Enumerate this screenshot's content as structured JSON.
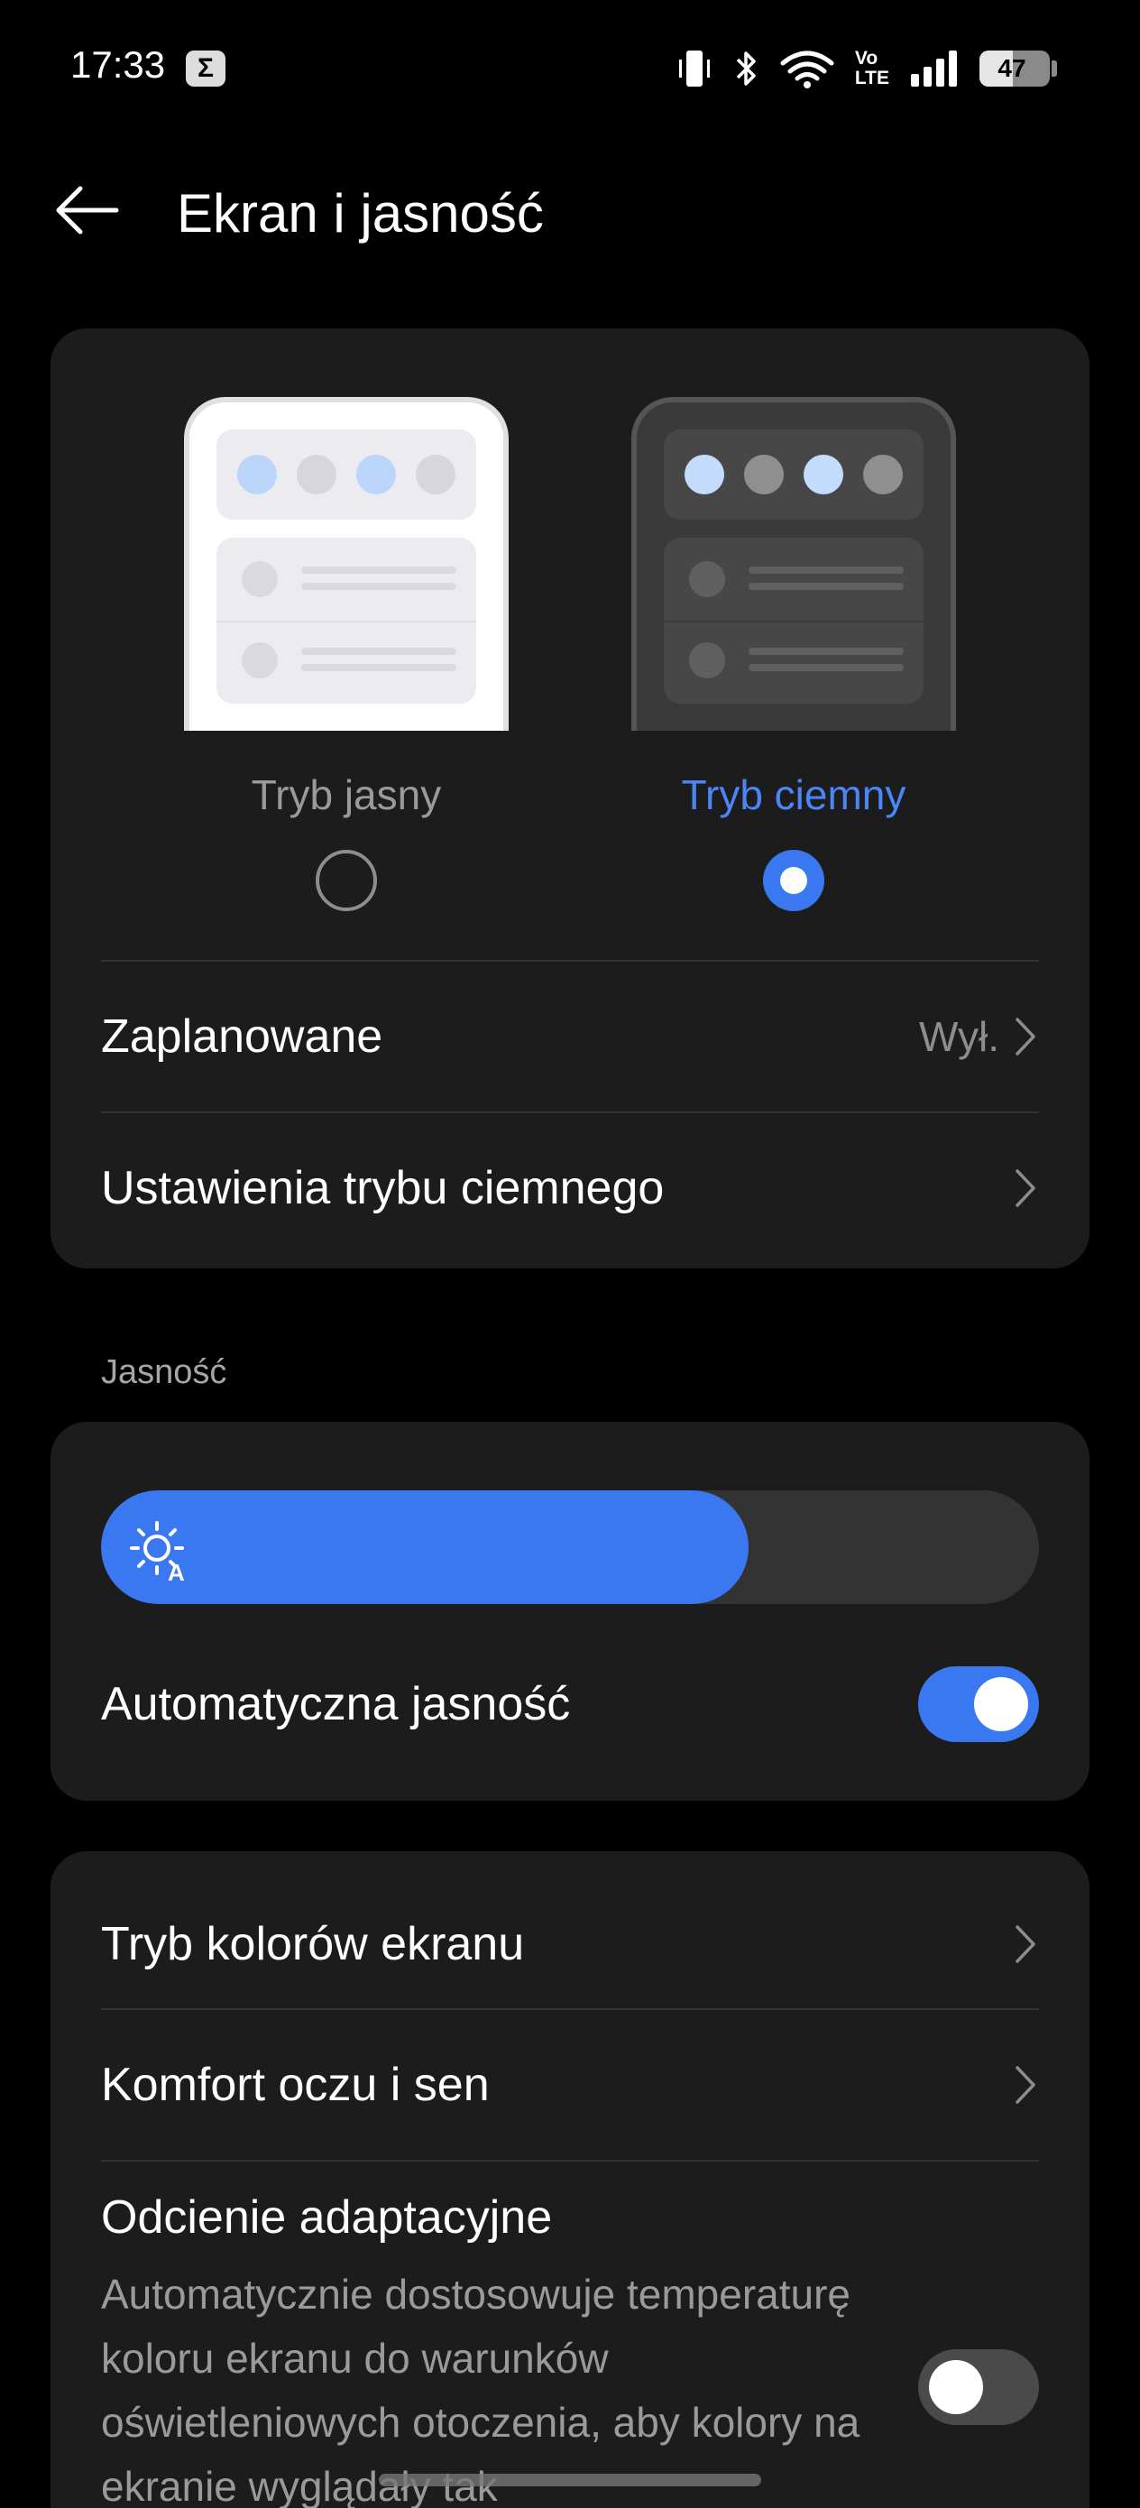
{
  "status_bar": {
    "time": "17:33",
    "notification_icon": "sigma-app-icon",
    "icons": [
      "vibrate-icon",
      "bluetooth-icon",
      "wifi-icon",
      "volte-icon",
      "signal-icon",
      "battery-icon"
    ],
    "volte_text_top": "Vo",
    "volte_text_bottom": "LTE",
    "battery_level": "47"
  },
  "header": {
    "title": "Ekran i jasność",
    "back_icon": "back-arrow-icon"
  },
  "theme_modes": {
    "light": {
      "label": "Tryb jasny",
      "selected": false
    },
    "dark": {
      "label": "Tryb ciemny",
      "selected": true
    }
  },
  "mode_rows": [
    {
      "label": "Zaplanowane",
      "value": "Wył."
    },
    {
      "label": "Ustawienia trybu ciemnego",
      "value": ""
    }
  ],
  "brightness": {
    "section_label": "Jasność",
    "level": 0.69,
    "auto_label": "Automatyczna jasność",
    "auto_enabled": true
  },
  "more_rows": [
    {
      "label": "Tryb kolorów ekranu"
    },
    {
      "label": "Komfort oczu i sen"
    }
  ],
  "adaptive_tone": {
    "title": "Odcienie adaptacyjne",
    "description": "Automatycznie dostosowuje temperaturę koloru ekranu do warunków oświetleniowych otoczenia, aby kolory na ekranie wyglądały tak",
    "enabled": false
  },
  "colors": {
    "accent": "#3a78f2",
    "background": "#000000",
    "card": "#1c1c1c"
  }
}
